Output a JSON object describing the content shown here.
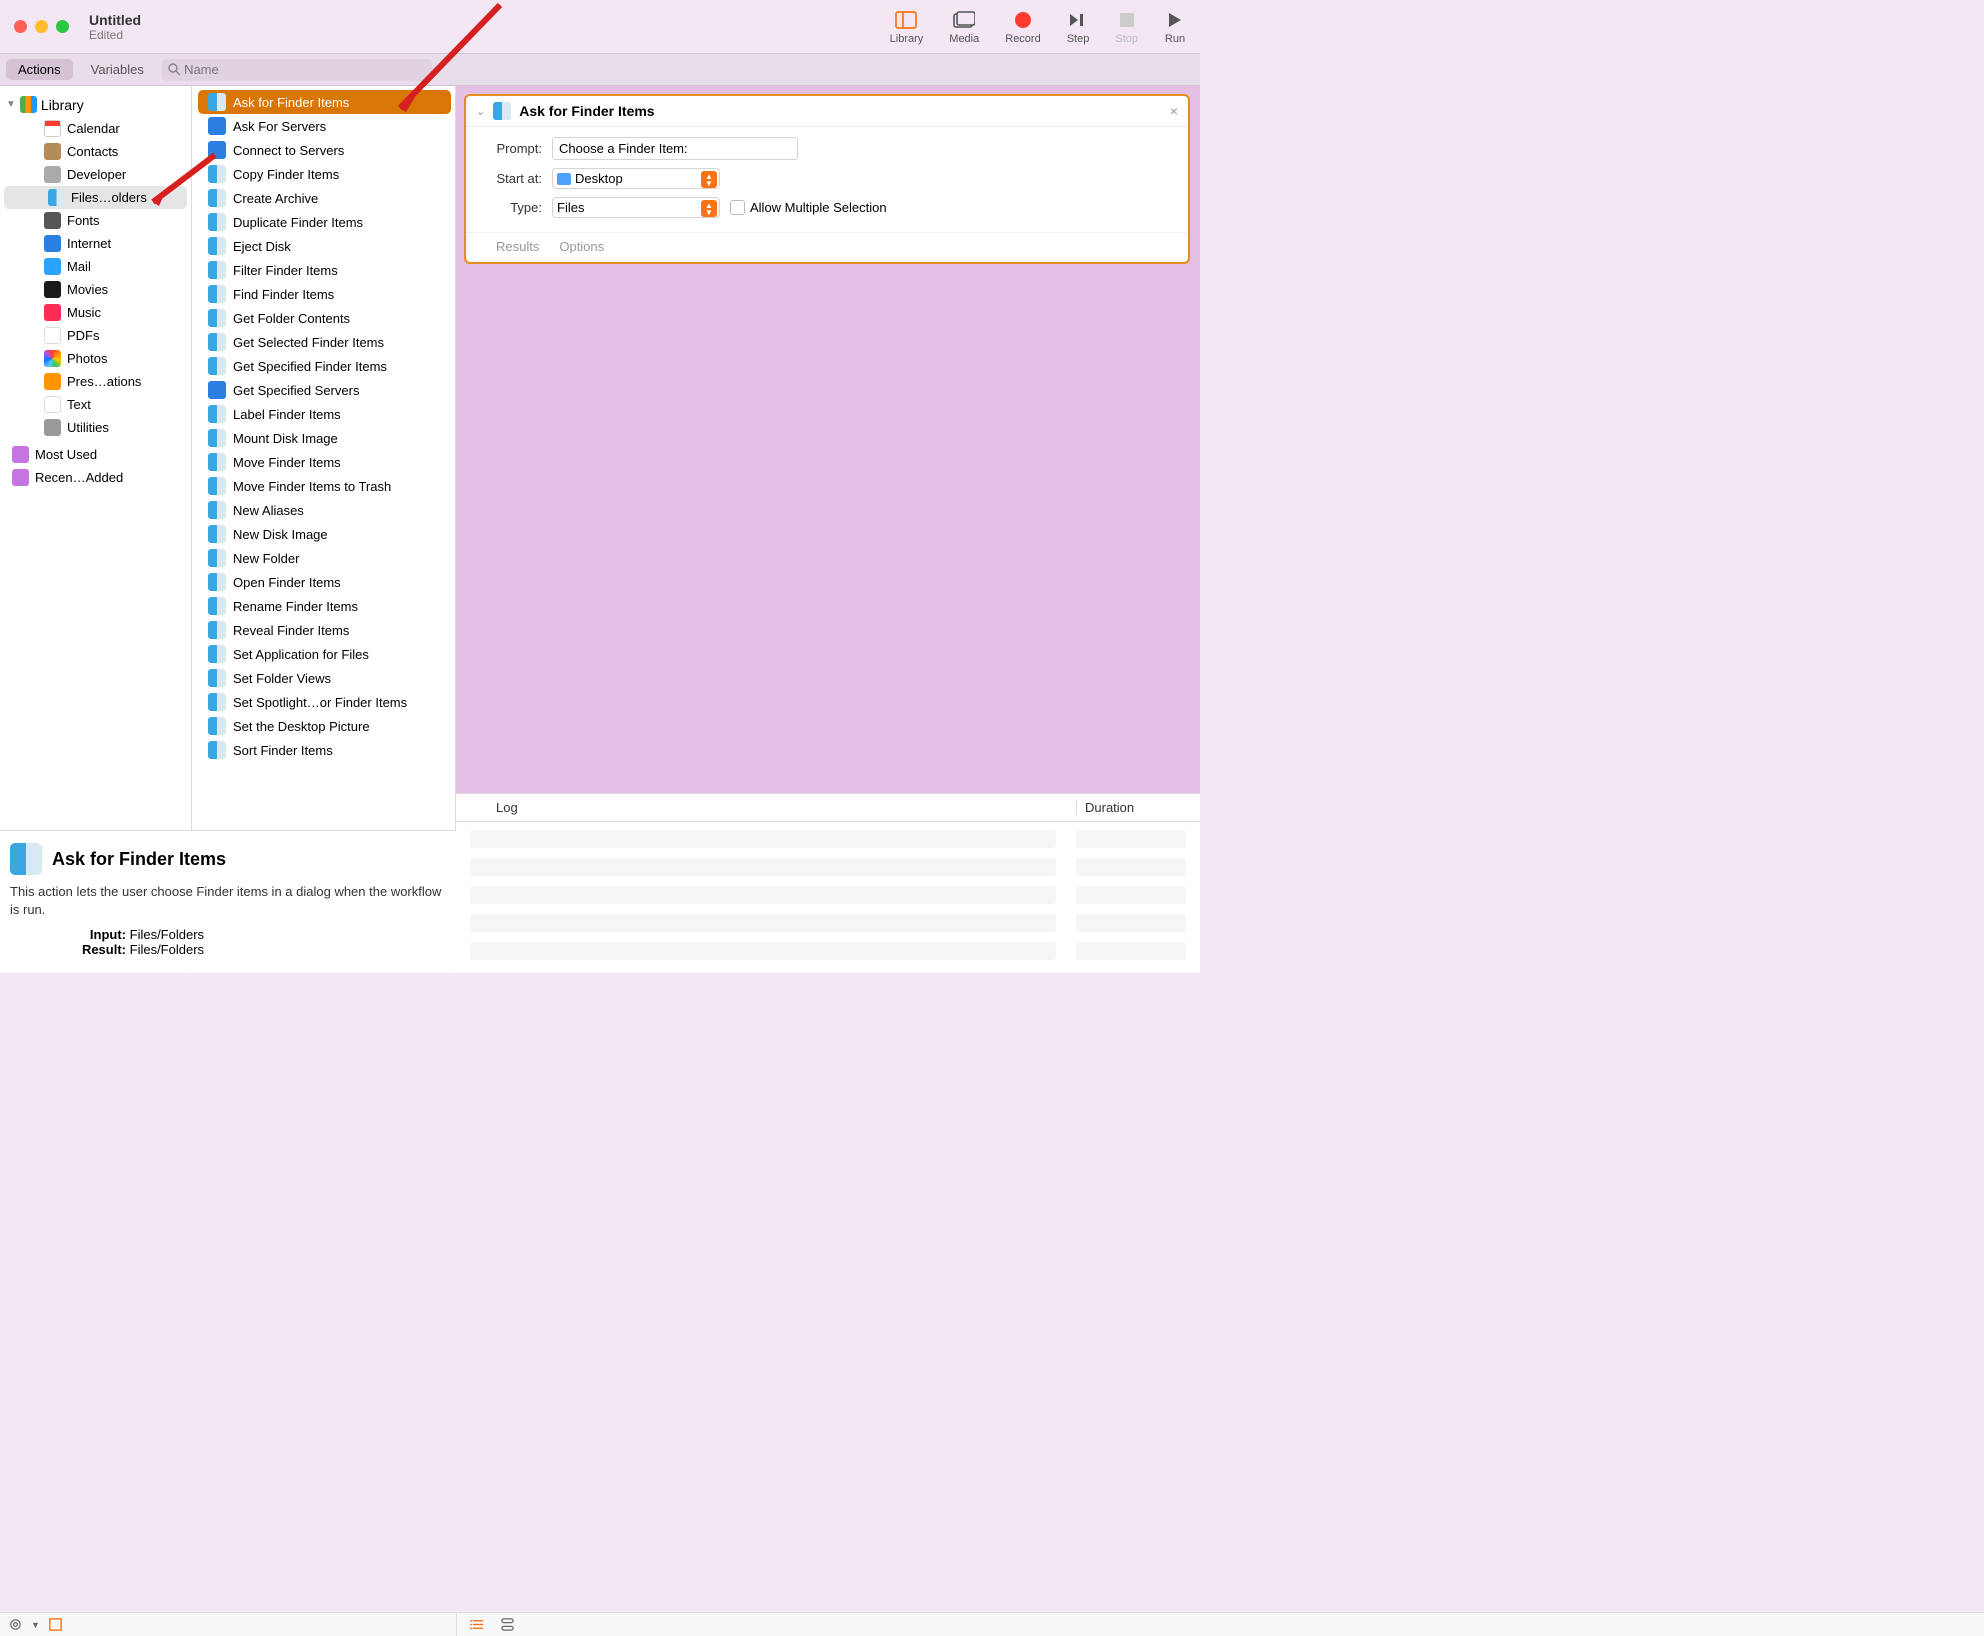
{
  "window": {
    "title": "Untitled",
    "subtitle": "Edited"
  },
  "toolbar": {
    "library": "Library",
    "media": "Media",
    "record": "Record",
    "step": "Step",
    "stop": "Stop",
    "run": "Run"
  },
  "tabs": {
    "actions": "Actions",
    "variables": "Variables"
  },
  "search": {
    "placeholder": "Name"
  },
  "library": {
    "root": "Library",
    "items": [
      "Calendar",
      "Contacts",
      "Developer",
      "Files…olders",
      "Fonts",
      "Internet",
      "Mail",
      "Movies",
      "Music",
      "PDFs",
      "Photos",
      "Pres…ations",
      "Text",
      "Utilities"
    ],
    "selected": "Files…olders",
    "extra": [
      "Most Used",
      "Recen…Added"
    ]
  },
  "actions": {
    "items": [
      "Ask for Finder Items",
      "Ask For Servers",
      "Connect to Servers",
      "Copy Finder Items",
      "Create Archive",
      "Duplicate Finder Items",
      "Eject Disk",
      "Filter Finder Items",
      "Find Finder Items",
      "Get Folder Contents",
      "Get Selected Finder Items",
      "Get Specified Finder Items",
      "Get Specified Servers",
      "Label Finder Items",
      "Mount Disk Image",
      "Move Finder Items",
      "Move Finder Items to Trash",
      "New Aliases",
      "New Disk Image",
      "New Folder",
      "Open Finder Items",
      "Rename Finder Items",
      "Reveal Finder Items",
      "Set Application for Files",
      "Set Folder Views",
      "Set Spotlight…or Finder Items",
      "Set the Desktop Picture",
      "Sort Finder Items"
    ],
    "selected": "Ask for Finder Items"
  },
  "card": {
    "title": "Ask for Finder Items",
    "prompt_label": "Prompt:",
    "prompt_value": "Choose a Finder Item:",
    "start_label": "Start at:",
    "start_value": "Desktop",
    "type_label": "Type:",
    "type_value": "Files",
    "multi_label": "Allow Multiple Selection",
    "tab_results": "Results",
    "tab_options": "Options"
  },
  "log": {
    "log": "Log",
    "duration": "Duration"
  },
  "desc": {
    "title": "Ask for Finder Items",
    "body": "This action lets the user choose Finder items in a dialog when the workflow is run.",
    "input_label": "Input:",
    "input_value": "Files/Folders",
    "result_label": "Result:",
    "result_value": "Files/Folders"
  }
}
